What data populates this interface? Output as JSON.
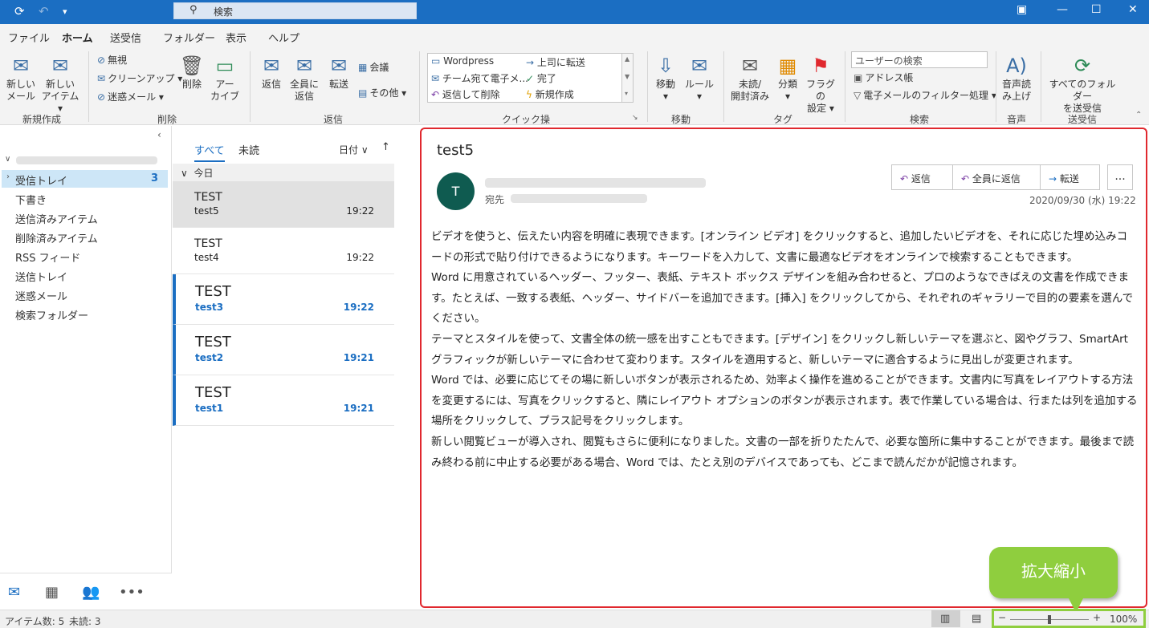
{
  "titlebar": {
    "search_text": "検索"
  },
  "menu": {
    "tabs": [
      "ファイル",
      "ホーム",
      "送受信",
      "フォルダー",
      "表示",
      "ヘルプ"
    ]
  },
  "ribbon": {
    "new_mail": "新しい\nメール",
    "new_mail_l1": "新しい",
    "new_mail_l2": "メール",
    "new_item_l1": "新しい",
    "new_item_l2": "アイテム",
    "group_new": "新規作成",
    "ignore": "無視",
    "cleanup": "クリーンアップ",
    "junk": "迷惑メール",
    "delete": "削除",
    "archive_l1": "アー",
    "archive_l2": "カイブ",
    "group_delete": "削除",
    "reply": "返信",
    "reply_all_l1": "全員に",
    "reply_all_l2": "返信",
    "forward": "転送",
    "meeting": "会議",
    "more": "その他",
    "group_reply": "返信",
    "qs_items": [
      "Wordpress",
      "チーム宛て電子メ...",
      "返信して削除",
      "上司に転送",
      "完了",
      "新規作成"
    ],
    "group_quick": "クイック操作",
    "move": "移動",
    "rule": "ルール",
    "group_move": "移動",
    "unread_l1": "未読/",
    "unread_l2": "開封済み",
    "categorize": "分類",
    "flag_l1": "フラグの",
    "flag_l2": "設定",
    "group_tag": "タグ",
    "user_search": "ユーザーの検索",
    "address_book": "アドレス帳",
    "filter_mail": "電子メールのフィルター処理",
    "group_search": "検索",
    "read_aloud_l1": "音声読",
    "read_aloud_l2": "み上げ",
    "group_speech": "音声",
    "send_all_l1": "すべてのフォルダー",
    "send_all_l2": "を送受信",
    "group_sendrecv": "送受信"
  },
  "folders": {
    "items": [
      "受信トレイ",
      "下書き",
      "送信済みアイテム",
      "削除済みアイテム",
      "RSS フィード",
      "送信トレイ",
      "迷惑メール",
      "検索フォルダー"
    ],
    "inbox_count": "3"
  },
  "list": {
    "tabs": [
      "すべて",
      "未読"
    ],
    "sort": "日付",
    "group_today": "今日",
    "messages": [
      {
        "sender": "TEST",
        "subject": "test5",
        "time": "19:22"
      },
      {
        "sender": "TEST",
        "subject": "test4",
        "time": "19:22"
      },
      {
        "sender": "TEST",
        "subject": "test3",
        "time": "19:22"
      },
      {
        "sender": "TEST",
        "subject": "test2",
        "time": "19:21"
      },
      {
        "sender": "TEST",
        "subject": "test1",
        "time": "19:21"
      }
    ]
  },
  "reading": {
    "subject": "test5",
    "avatar_initial": "T",
    "to_label": "宛先",
    "reply": "返信",
    "reply_all": "全員に返信",
    "forward": "転送",
    "more": "...",
    "date": "2020/09/30 (水) 19:22",
    "body": [
      "ビデオを使うと、伝えたい内容を明確に表現できます。[オンライン ビデオ] をクリックすると、追加したいビデオを、それに応じた埋め込みコードの形式で貼り付けできるようになります。キーワードを入力して、文書に最適なビデオをオンラインで検索することもできます。",
      "Word に用意されているヘッダー、フッター、表紙、テキスト ボックス デザインを組み合わせると、プロのようなできばえの文書を作成できます。たとえば、一致する表紙、ヘッダー、サイドバーを追加できます。[挿入] をクリックしてから、それぞれのギャラリーで目的の要素を選んでください。",
      "テーマとスタイルを使って、文書全体の統一感を出すこともできます。[デザイン] をクリックし新しいテーマを選ぶと、図やグラフ、SmartArt グラフィックが新しいテーマに合わせて変わります。スタイルを適用すると、新しいテーマに適合するように見出しが変更されます。",
      "Word では、必要に応じてその場に新しいボタンが表示されるため、効率よく操作を進めることができます。文書内に写真をレイアウトする方法を変更するには、写真をクリックすると、隣にレイアウト オプションのボタンが表示されます。表で作業している場合は、行または列を追加する場所をクリックして、プラス記号をクリックします。",
      "新しい閲覧ビューが導入され、閲覧もさらに便利になりました。文書の一部を折りたたんで、必要な箇所に集中することができます。最後まで読み終わる前に中止する必要がある場合、Word では、たとえ別のデバイスであっても、どこまで読んだかが記憶されます。"
    ]
  },
  "callout": {
    "text": "拡大縮小"
  },
  "status": {
    "items": "アイテム数: 5",
    "unread": "未読: 3",
    "zoom": "100%",
    "zoom_level_percent": 100
  },
  "colors": {
    "accent": "#1b6ec2",
    "highlight_red": "#e0282e",
    "callout_green": "#8fce3e"
  }
}
